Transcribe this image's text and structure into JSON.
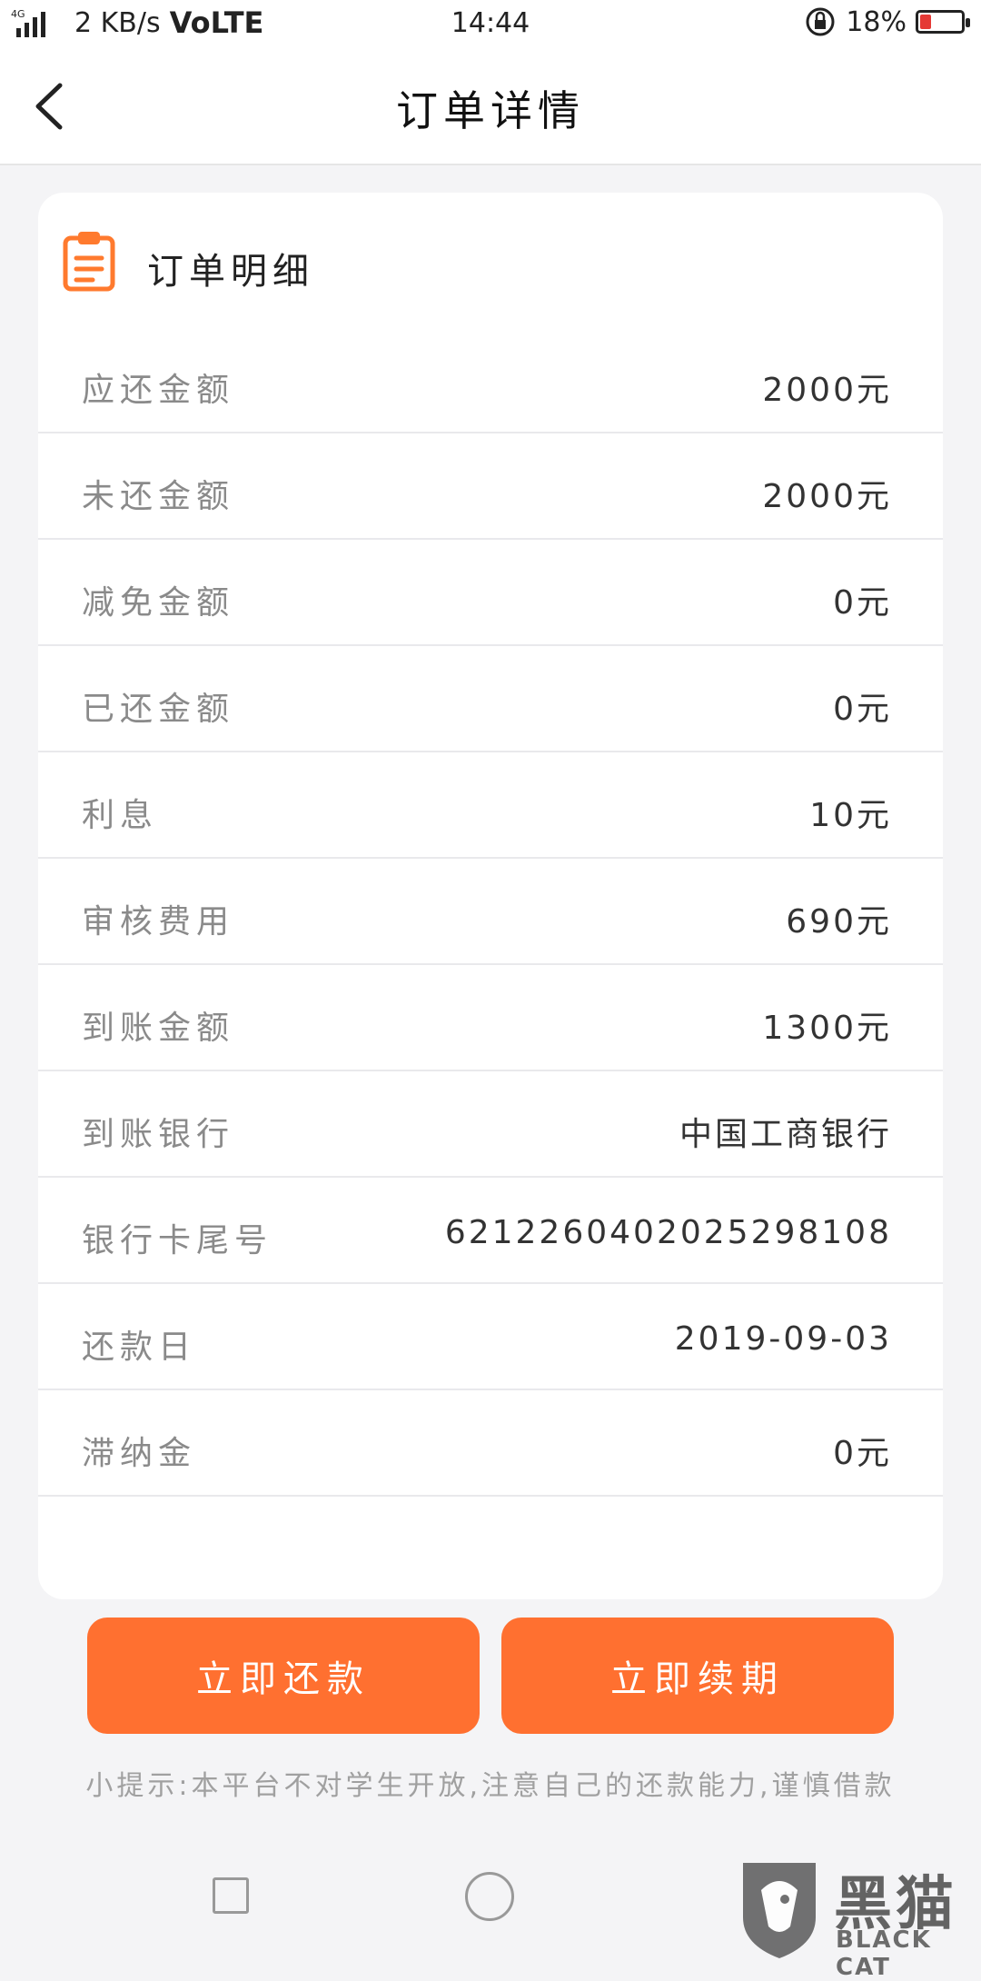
{
  "status_bar": {
    "network": "4G",
    "speed": "2 KB/s",
    "volte": "VoLTE",
    "time": "14:44",
    "battery": "18%",
    "battery_color": "#e53935"
  },
  "header": {
    "title": "订单详情",
    "back_icon": "chevron-left-icon"
  },
  "card": {
    "title": "订单明细",
    "icon": "clipboard-icon",
    "icon_color": "#ff7a2e",
    "rows": [
      {
        "label": "应还金额",
        "value": "2000元"
      },
      {
        "label": "未还金额",
        "value": "2000元"
      },
      {
        "label": "减免金额",
        "value": "0元"
      },
      {
        "label": "已还金额",
        "value": "0元"
      },
      {
        "label": "利息",
        "value": "10元"
      },
      {
        "label": "审核费用",
        "value": "690元"
      },
      {
        "label": "到账金额",
        "value": "1300元"
      },
      {
        "label": "到账银行",
        "value": "中国工商银行"
      },
      {
        "label": "银行卡尾号",
        "value": "6212260402025298108"
      },
      {
        "label": "还款日",
        "value": "2019-09-03"
      },
      {
        "label": "滞纳金",
        "value": "0元"
      }
    ]
  },
  "actions": {
    "repay_label": "立即还款",
    "extend_label": "立即续期",
    "accent_color": "#ff7030"
  },
  "tip": "小提示:本平台不对学生开放,注意自己的还款能力,谨慎借款",
  "watermark": {
    "cn": "黑猫",
    "en": "BLACK CAT"
  }
}
